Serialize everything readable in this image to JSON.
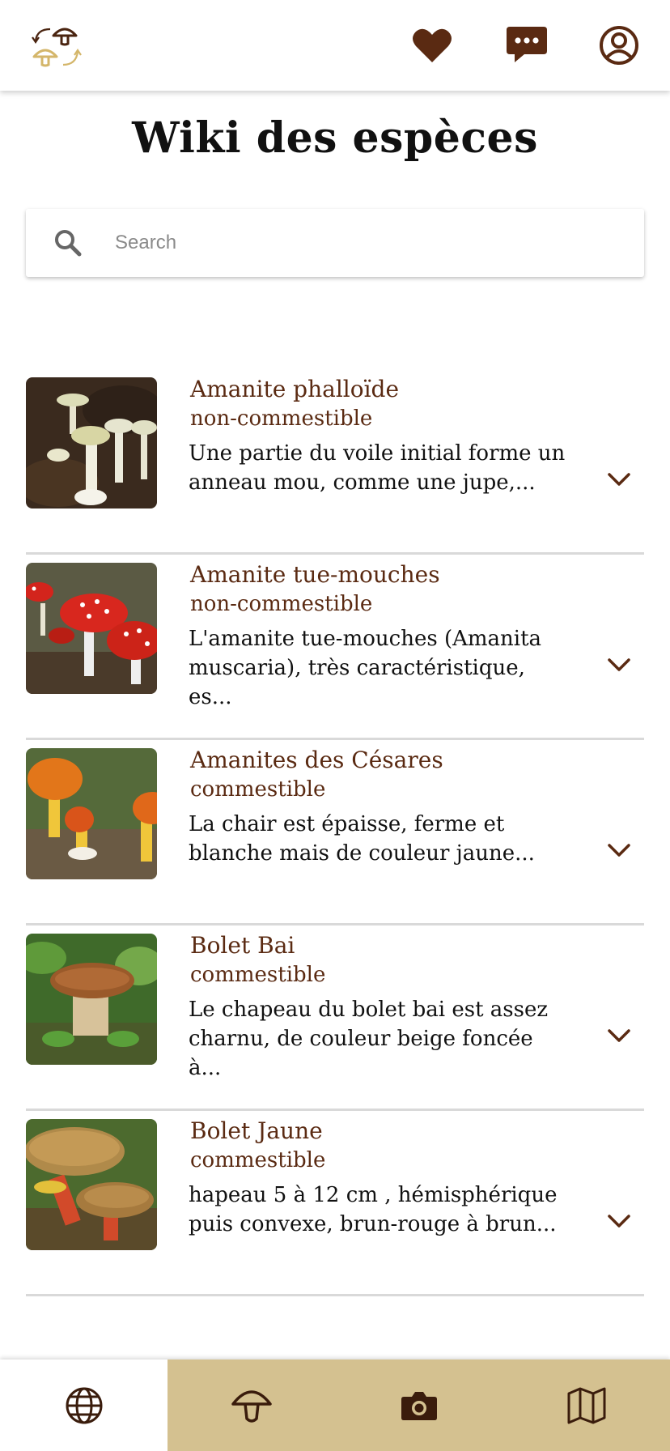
{
  "header": {
    "logo_icon": "mushroom-swap-logo",
    "actions": [
      {
        "name": "favorites",
        "icon": "heart-icon"
      },
      {
        "name": "messages",
        "icon": "chat-icon"
      },
      {
        "name": "profile",
        "icon": "user-circle-icon"
      }
    ]
  },
  "page": {
    "title": "Wiki des espèces"
  },
  "search": {
    "placeholder": "Search",
    "value": ""
  },
  "species": [
    {
      "name": "Amanite phalloïde",
      "status": "non-commestible",
      "description": "Une partie du voile initial forme un anneau mou, comme une jupe,..."
    },
    {
      "name": "Amanite tue-mouches",
      "status": "non-commestible",
      "description": "L'amanite tue-mouches (Amanita muscaria), très caractéristique, es..."
    },
    {
      "name": "Amanites des Césares",
      "status": "commestible",
      "description": "La chair est épaisse, ferme et blanche mais de couleur jaune..."
    },
    {
      "name": "Bolet Bai",
      "status": "commestible",
      "description": "Le chapeau du bolet bai est assez charnu, de couleur beige foncée à..."
    },
    {
      "name": "Bolet Jaune",
      "status": "commestible",
      "description": "hapeau 5 à 12 cm , hémisphérique puis convexe, brun-rouge à brun..."
    }
  ],
  "bottom_nav": [
    {
      "name": "explore",
      "icon": "globe-icon",
      "active": true
    },
    {
      "name": "species-wiki",
      "icon": "mushroom-icon",
      "active": false
    },
    {
      "name": "camera",
      "icon": "camera-icon",
      "active": false
    },
    {
      "name": "map",
      "icon": "map-icon",
      "active": false
    }
  ],
  "colors": {
    "brand_brown": "#5a2a12",
    "nav_tan": "#d4c190",
    "logo_tan": "#d4b66a"
  }
}
